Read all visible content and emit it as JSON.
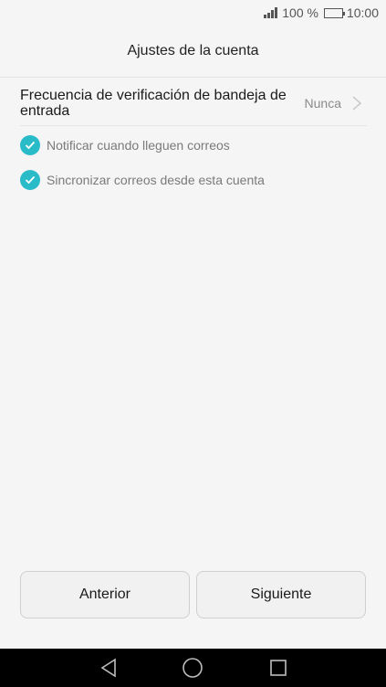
{
  "status_bar": {
    "battery_text": "100 %",
    "time": "10:00",
    "battery_level": 1.0,
    "signal_icon": "signal-bars-icon",
    "battery_icon": "battery-icon"
  },
  "header": {
    "title": "Ajustes de la cuenta"
  },
  "settings": {
    "frequency_label": "Frecuencia de verificación de bandeja de entrada",
    "frequency_value": "Nunca",
    "frequency_icon": "chevron-right-icon",
    "options": [
      {
        "label": "Notificar cuando lleguen correos",
        "checked": true
      },
      {
        "label": "Sincronizar correos desde esta cuenta",
        "checked": true
      }
    ]
  },
  "buttons": {
    "previous_label": "Anterior",
    "next_label": "Siguiente"
  },
  "nav_bar": {
    "back_icon": "back-triangle-icon",
    "home_icon": "home-circle-icon",
    "recents_icon": "recents-square-icon"
  },
  "colors": {
    "accent": "#2abbc9",
    "background": "#f5f5f5",
    "nav_background": "#000000"
  }
}
